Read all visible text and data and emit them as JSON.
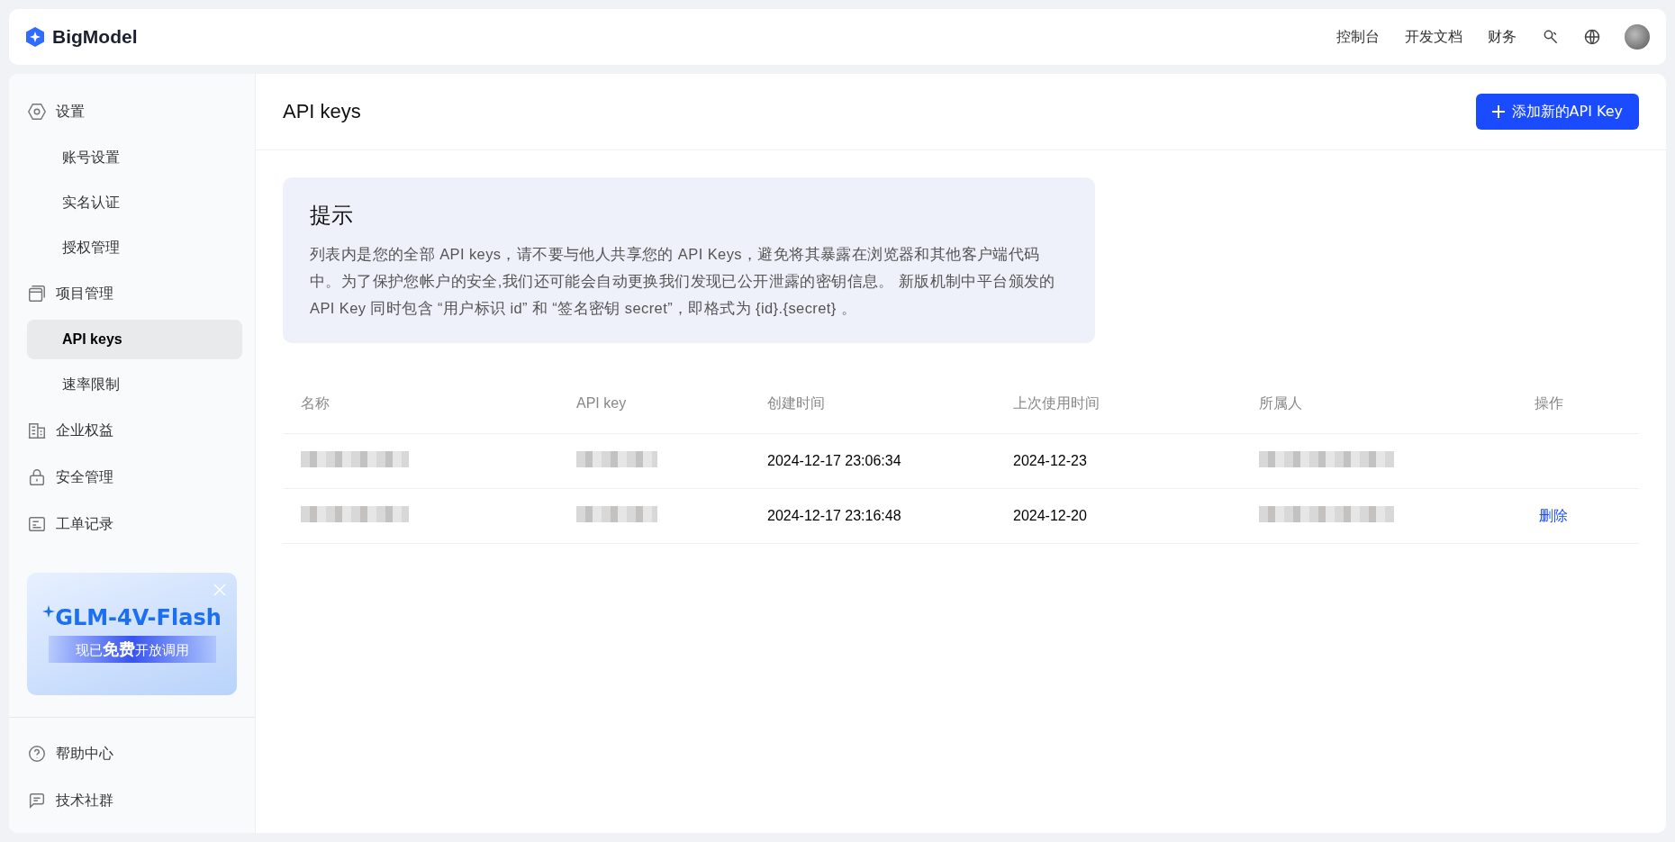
{
  "topbar": {
    "logo": "BigModel",
    "nav": [
      "控制台",
      "开发文档",
      "财务"
    ]
  },
  "sidebar": {
    "groups": [
      {
        "label": "设置",
        "selected": false,
        "children": [
          {
            "label": "账号设置",
            "selected": false
          },
          {
            "label": "实名认证",
            "selected": false
          },
          {
            "label": "授权管理",
            "selected": false
          }
        ]
      },
      {
        "label": "项目管理",
        "selected": false,
        "children": [
          {
            "label": "API keys",
            "selected": true
          },
          {
            "label": "速率限制",
            "selected": false
          }
        ]
      },
      {
        "label": "企业权益",
        "selected": false
      },
      {
        "label": "安全管理",
        "selected": false
      },
      {
        "label": "工单记录",
        "selected": false
      }
    ],
    "promo": {
      "title": "GLM-4V-Flash",
      "subtitle": "现已**免费**开放调用"
    },
    "footer": [
      {
        "label": "帮助中心"
      },
      {
        "label": "技术社群"
      }
    ]
  },
  "main": {
    "title": "API keys",
    "add_button": "添加新的API Key",
    "notice": {
      "title": "提示",
      "text": "列表内是您的全部 API keys，请不要与他人共享您的 API Keys，避免将其暴露在浏览器和其他客户端代码中。为了保护您帐户的安全,我们还可能会自动更换我们发现已公开泄露的密钥信息。 新版机制中平台颁发的 API Key 同时包含 “用户标识 id” 和 “签名密钥 secret”，即格式为 {id}.{secret} 。"
    },
    "table": {
      "columns": [
        "名称",
        "API key",
        "创建时间",
        "上次使用时间",
        "所属人",
        "操作"
      ],
      "rows": [
        {
          "name_redacted": true,
          "key_redacted": true,
          "created": "2024-12-17 23:06:34",
          "last_used": "2024-12-23",
          "owner_redacted": true
        },
        {
          "name_redacted": true,
          "key_redacted": true,
          "created": "2024-12-17 23:16:48",
          "last_used": "2024-12-20",
          "owner_redacted": true,
          "action": "删除"
        }
      ]
    }
  }
}
